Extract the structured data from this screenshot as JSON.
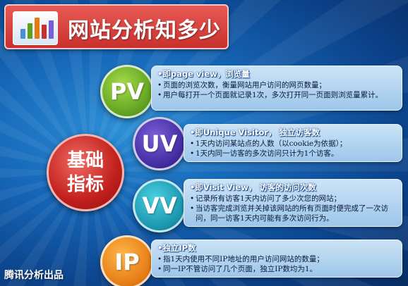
{
  "title": "网站分析知多少",
  "core": {
    "line1": "基础",
    "line2": "指标"
  },
  "metrics": [
    {
      "label": "PV",
      "color": "#5fa020",
      "heading": "•即page view，浏览量",
      "items": [
        "页面的浏览次数，衡量网站用户访问的网页数量；",
        "用户每打开一个页面就记录1次，多次打开同一页面则浏览量累计。"
      ]
    },
    {
      "label": "UV",
      "color": "#3f2a9e",
      "heading": "•即Unique Visitor， 独立访客数",
      "items": [
        "1天内访问某站点的人数（以cookie为依据）；",
        "1天内同一访客的多次访问只计为1个访客。"
      ]
    },
    {
      "label": "VV",
      "color": "#1893ad",
      "heading": "•即Visit View， 访客的访问次数",
      "items": [
        "记录所有访客1天内访问了多少次您的网站；",
        "当访客完成浏览并关掉该网站的所有页面时便完成了一次访问，同一访客1天内可能有多次访问行为。"
      ]
    },
    {
      "label": "IP",
      "color": "#e47a12",
      "heading": "•独立IP数",
      "items": [
        "指1天内使用不同IP地址的用户访问网站的数量；",
        "同一IP不管访问了几个页面，独立IP数均为1。"
      ]
    }
  ],
  "footer": "腾讯分析出品"
}
